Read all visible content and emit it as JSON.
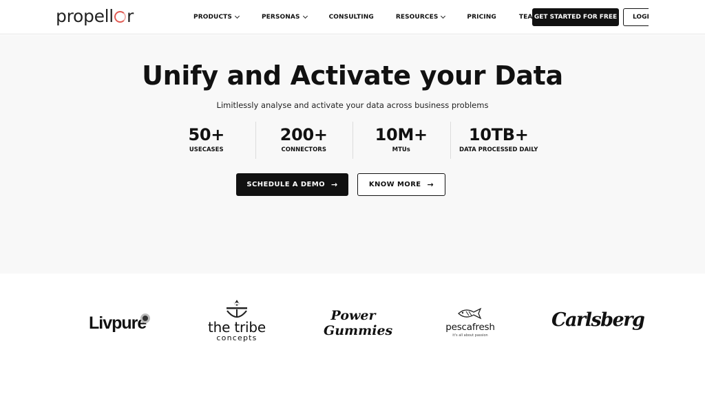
{
  "header": {
    "logo_text_pre": "propell",
    "logo_text_post": "r",
    "nav": [
      {
        "label": "PRODUCTS",
        "dropdown": true
      },
      {
        "label": "PERSONAS",
        "dropdown": true
      },
      {
        "label": "CONSULTING",
        "dropdown": false
      },
      {
        "label": "RESOURCES",
        "dropdown": true
      },
      {
        "label": "PRICING",
        "dropdown": false
      },
      {
        "label": "TEAM",
        "dropdown": true
      }
    ],
    "start_label": "GET STARTED FOR FREE",
    "login_label": "LOGIN"
  },
  "hero": {
    "title": "Unify and Activate your Data",
    "subtitle": "Limitlessly analyse and activate your data across business problems",
    "stats": [
      {
        "value": "50+",
        "label": "USECASES"
      },
      {
        "value": "200+",
        "label": "CONNECTORS"
      },
      {
        "value": "10M+",
        "label": "MTUs"
      },
      {
        "value": "10TB+",
        "label": "DATA PROCESSED DAILY"
      }
    ],
    "demo_label": "SCHEDULE A DEMO",
    "know_label": "KNOW MORE",
    "arrow": "→"
  },
  "clients": {
    "livpure": "Livpure",
    "tribe_1": "the tribe",
    "tribe_2": "concepts",
    "gummies_1": "Power",
    "gummies_2": "Gummies",
    "pesca_1": "pescafresh",
    "pesca_2": "it's all about passion",
    "carlsberg": "Carlsberg"
  },
  "colors": {
    "accent": "#e05a52",
    "primary_button": "#111111",
    "hero_background": "#f8f8f8"
  },
  "icons": {
    "dropdown": "chevron-down-icon",
    "cta_arrow": "arrow-right-icon"
  }
}
